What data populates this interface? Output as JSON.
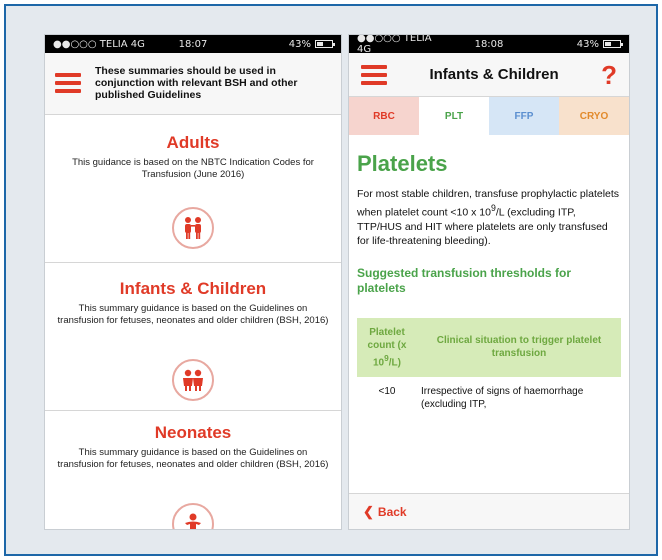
{
  "colors": {
    "accent": "#e03a27",
    "platelet_green": "#4aa34a",
    "frame_blue": "#1d67a8"
  },
  "left_phone": {
    "status": {
      "carrier": "●●○○○ TELIA 4G",
      "time": "18:07",
      "battery": "43%"
    },
    "header_note": "These summaries should be used in conjunction with relevant BSH and other published Guidelines",
    "guides": [
      {
        "title": "Adults",
        "description": "This guidance is based on the NBTC Indication Codes for Transfusion (June 2016)",
        "icon": "adults-icon"
      },
      {
        "title": "Infants & Children",
        "description": "This summary guidance is based on the Guidelines on transfusion for fetuses, neonates and older children (BSH, 2016)",
        "icon": "children-icon"
      },
      {
        "title": "Neonates",
        "description": "This summary guidance is based on the Guidelines on transfusion for fetuses, neonates and older children (BSH, 2016)",
        "icon": "baby-icon"
      }
    ]
  },
  "right_phone": {
    "status": {
      "carrier": "●●○○○ TELIA 4G",
      "time": "18:08",
      "battery": "43%"
    },
    "title": "Infants & Children",
    "help": "?",
    "tabs": [
      "RBC",
      "PLT",
      "FFP",
      "CRYO"
    ],
    "section_title": "Platelets",
    "body_parts": {
      "before_sup": "For most stable children, transfuse prophylactic platelets when platelet count <10 x 10",
      "sup": "9",
      "after_sup": "/L (excluding ITP, TTP/HUS and HIT where platelets are only transfused for life-threatening bleeding)."
    },
    "threshold_title": "Suggested transfusion thresholds for platelets",
    "table": {
      "col1_header": "Platelet count (x 10",
      "col1_sup": "9",
      "col1_tail": "/L)",
      "col2_header": "Clinical situation to trigger platelet transfusion",
      "rows": [
        {
          "count": "<10",
          "situation": "Irrespective of signs of haemorrhage (excluding ITP,"
        }
      ]
    },
    "back_label": "Back"
  }
}
